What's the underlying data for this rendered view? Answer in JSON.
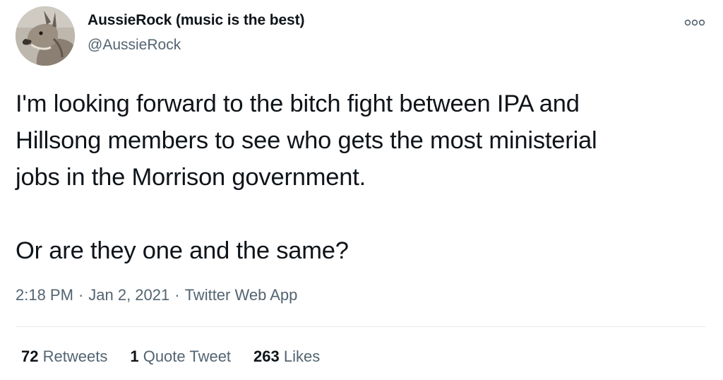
{
  "author": {
    "display_name": "AussieRock (music is the best)",
    "handle": "@AussieRock",
    "avatar_icon": "wallaby-avatar"
  },
  "more_icon": "more-options-icon",
  "tweet": {
    "paragraph_1": "I'm looking forward to the bitch fight between IPA and\nHillsong members to see who gets the most ministerial\njobs in the Morrison government.",
    "paragraph_2": "Or are they one and the same?"
  },
  "meta": {
    "time": "2:18 PM",
    "separator": "·",
    "date": "Jan 2, 2021",
    "source": "Twitter Web App"
  },
  "stats": {
    "retweets": {
      "count": "72",
      "label": "Retweets"
    },
    "quotes": {
      "count": "1",
      "label": "Quote Tweet"
    },
    "likes": {
      "count": "263",
      "label": "Likes"
    }
  },
  "colors": {
    "text": "#0f1419",
    "secondary": "#536471",
    "divider": "#e7e9ea"
  }
}
